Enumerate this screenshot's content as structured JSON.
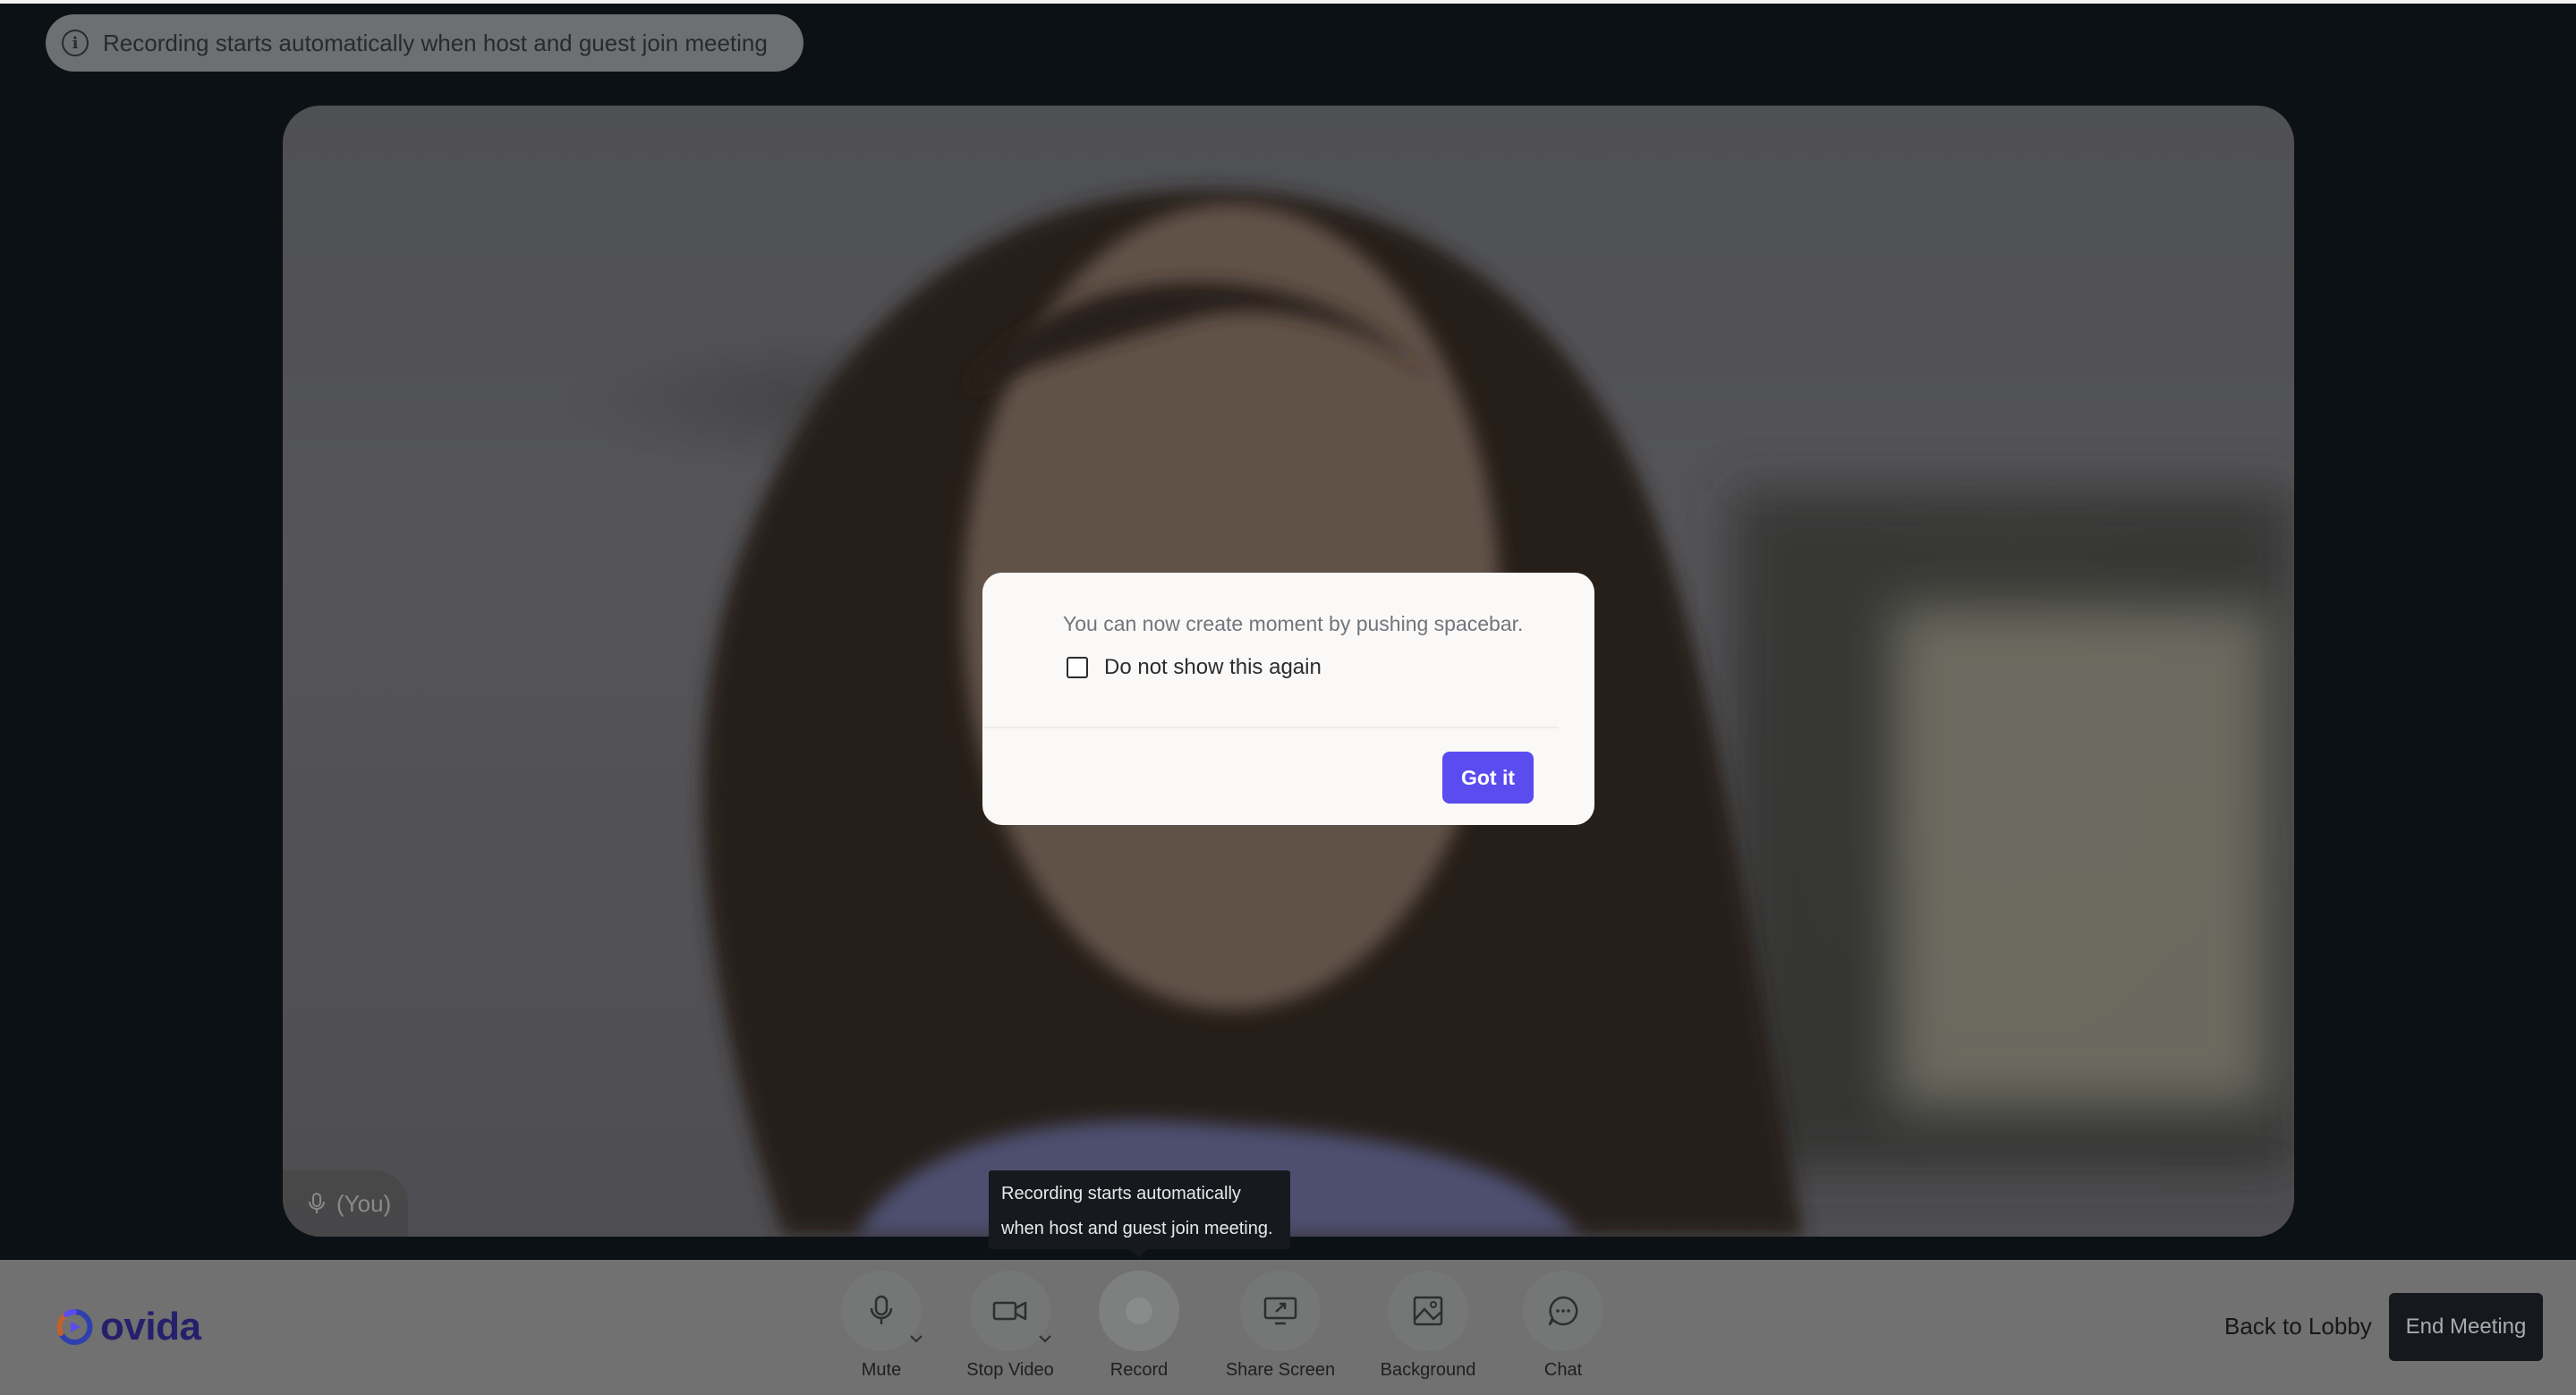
{
  "banner": {
    "icon": "info-icon",
    "text": "Recording starts automatically when host and guest join meeting"
  },
  "video": {
    "participant_label": "(You)",
    "mic_icon": "mic-icon"
  },
  "modal": {
    "message": "You can now create moment by pushing spacebar.",
    "checkbox_label": "Do not show this again",
    "checkbox_checked": false,
    "button_label": "Got it",
    "accent": "#5b4cf0"
  },
  "tooltip": {
    "line1": "Recording starts automatically",
    "line2": "when host and guest join meeting."
  },
  "toolbar": {
    "brand": "ovida",
    "items": [
      {
        "label": "Mute",
        "icon": "mic-icon"
      },
      {
        "label": "Stop Video",
        "icon": "video-camera-icon"
      },
      {
        "label": "Record",
        "icon": "record-icon"
      },
      {
        "label": "Share Screen",
        "icon": "share-screen-icon"
      },
      {
        "label": "Background",
        "icon": "image-icon"
      },
      {
        "label": "Chat",
        "icon": "chat-icon"
      }
    ],
    "back_label": "Back to Lobby",
    "end_label": "End Meeting"
  }
}
